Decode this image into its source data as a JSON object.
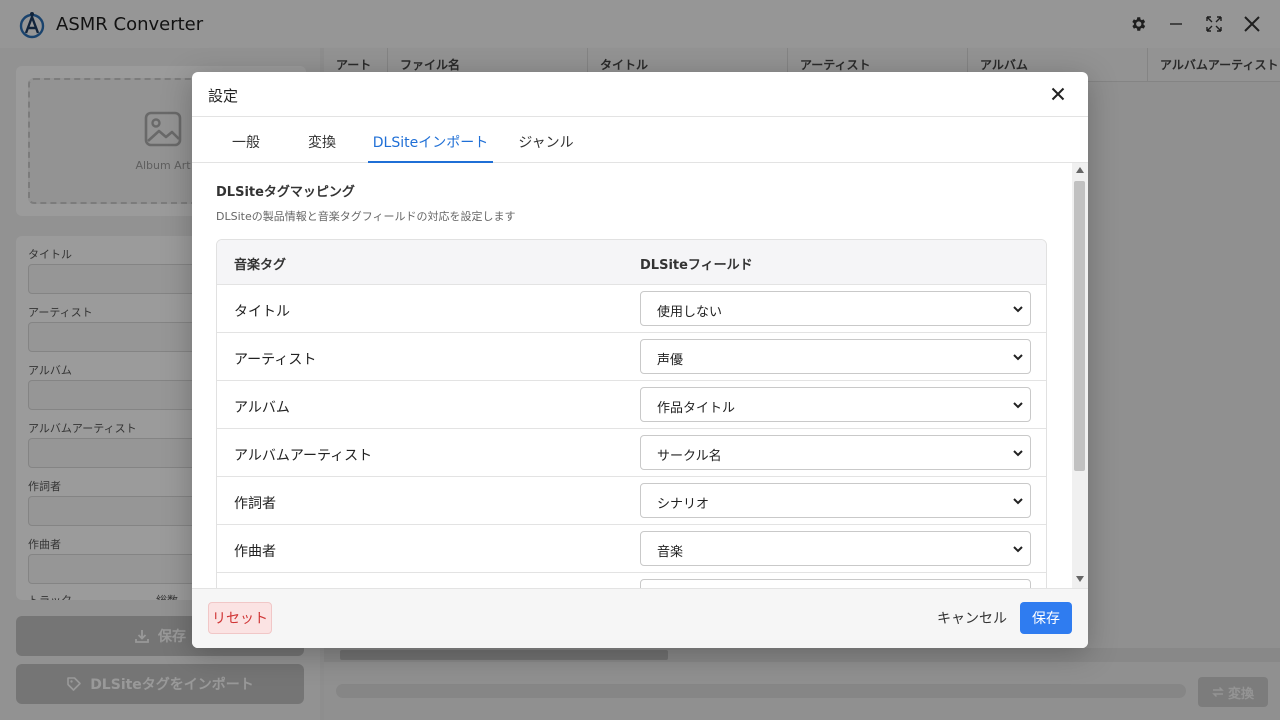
{
  "window": {
    "title": "ASMR Converter"
  },
  "left_panel": {
    "album_art_label": "Album Art",
    "fields": [
      {
        "label": "タイトル"
      },
      {
        "label": "アーティスト"
      },
      {
        "label": "アルバム"
      },
      {
        "label": "アルバムアーティスト"
      },
      {
        "label": "作詞者"
      },
      {
        "label": "作曲者"
      },
      {
        "label": "トラック"
      },
      {
        "label": "総数"
      }
    ],
    "save_label": "保存",
    "import_label": "DLSiteタグをインポート"
  },
  "table": {
    "columns": [
      "アート",
      "ファイル名",
      "タイトル",
      "アーティスト",
      "アルバム",
      "アルバムアーティスト"
    ]
  },
  "bottom": {
    "convert_label": "変換"
  },
  "modal": {
    "title": "設定",
    "tabs": [
      {
        "label": "一般"
      },
      {
        "label": "変換"
      },
      {
        "label": "DLSiteインポート",
        "active": true
      },
      {
        "label": "ジャンル"
      }
    ],
    "section_title": "DLSiteタグマッピング",
    "section_desc": "DLSiteの製品情報と音楽タグフィールドの対応を設定します",
    "table_headers": {
      "tag": "音楽タグ",
      "field": "DLSiteフィールド"
    },
    "rows": [
      {
        "tag": "タイトル",
        "value": "使用しない"
      },
      {
        "tag": "アーティスト",
        "value": "声優"
      },
      {
        "tag": "アルバム",
        "value": "作品タイトル"
      },
      {
        "tag": "アルバムアーティスト",
        "value": "サークル名"
      },
      {
        "tag": "作詞者",
        "value": "シナリオ"
      },
      {
        "tag": "作曲者",
        "value": "音楽"
      },
      {
        "tag": "",
        "value": ""
      }
    ],
    "reset_label": "リセット",
    "cancel_label": "キャンセル",
    "save_label": "保存"
  },
  "colors": {
    "accent": "#2f7cf0",
    "active_tab": "#1f6fd6",
    "reset_bg": "#fbe3e3",
    "reset_text": "#d03535"
  }
}
